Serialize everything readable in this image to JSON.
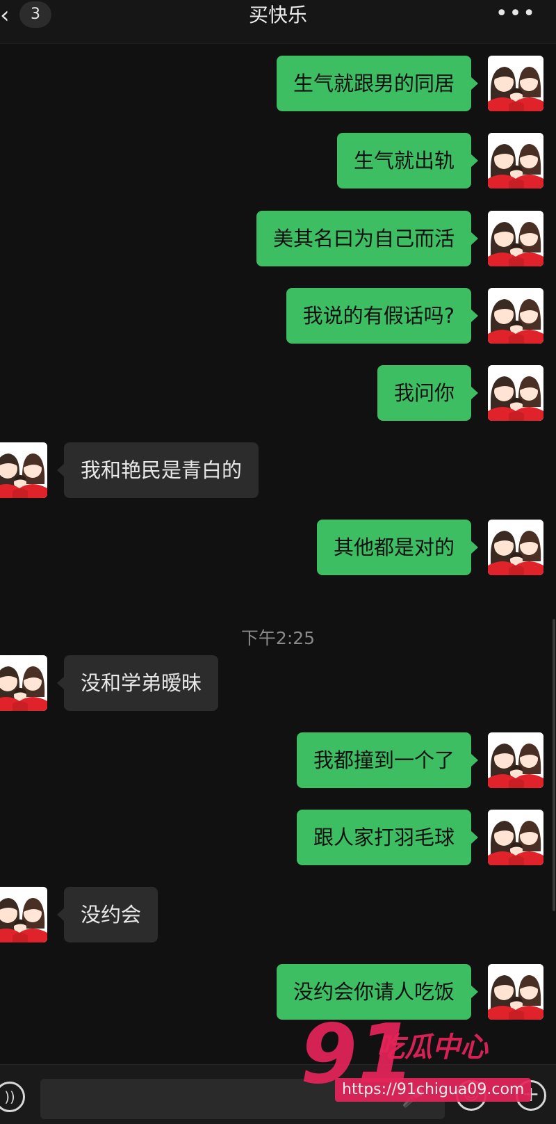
{
  "header": {
    "back_icon": "chevron-left-icon",
    "unread_count": "3",
    "title": "买快乐",
    "more_icon": "more-dots-icon"
  },
  "messages": [
    {
      "side": "out",
      "text": "生气就跟男的同居"
    },
    {
      "side": "out",
      "text": "生气就出轨"
    },
    {
      "side": "out",
      "text": "美其名曰为自己而活"
    },
    {
      "side": "out",
      "text": "我说的有假话吗?"
    },
    {
      "side": "out",
      "text": "我问你"
    },
    {
      "side": "in",
      "text": "我和艳民是青白的"
    },
    {
      "side": "out",
      "text": "其他都是对的"
    },
    {
      "side": "in",
      "text": "没和学弟暧昧"
    },
    {
      "side": "out",
      "text": "我都撞到一个了"
    },
    {
      "side": "out",
      "text": "跟人家打羽毛球"
    },
    {
      "side": "in",
      "text": "没约会"
    },
    {
      "side": "out",
      "text": "没约会你请人吃饭"
    }
  ],
  "timestamp": "下午2:25",
  "input_bar": {
    "voice_icon": "voice-icon",
    "mic_icon": "microphone-icon",
    "emoji_icon": "emoji-icon",
    "plus_icon": "plus-icon"
  },
  "watermark": {
    "number": "91",
    "name": "吃瓜中心",
    "url": "https://91chigua09.com"
  },
  "colors": {
    "background": "#111111",
    "outgoing_bubble": "#3dbe63",
    "incoming_bubble": "#2c2c2c",
    "watermark": "#e6245a"
  }
}
